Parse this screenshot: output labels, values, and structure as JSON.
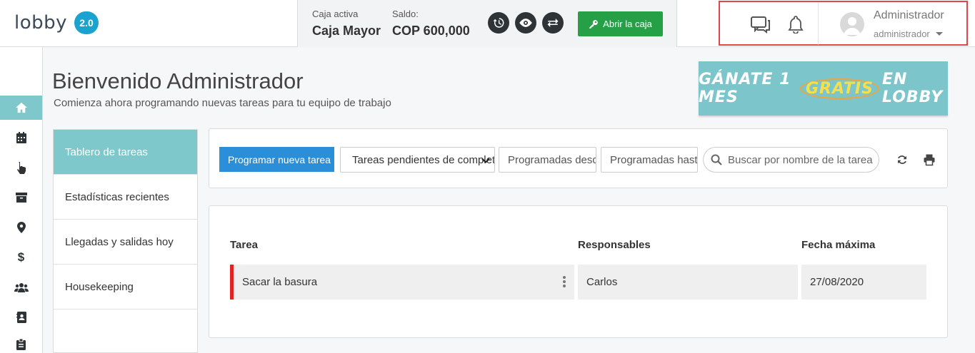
{
  "brand": {
    "logo_text": "lobby",
    "version": "2.0"
  },
  "cashbox": {
    "active_label": "Caja activa",
    "active_value": "Caja Mayor",
    "balance_label": "Saldo:",
    "balance_value": "COP 600,000",
    "open_button": "Abrir la caja",
    "icons": [
      "history-icon",
      "eye-icon",
      "transfer-icon",
      "key-icon"
    ]
  },
  "user": {
    "name": "Administrador",
    "role": "administrador",
    "icons": [
      "chat-icon",
      "bell-icon",
      "avatar-icon",
      "chevron-down-icon"
    ]
  },
  "sidebar": {
    "icons": [
      "home-icon",
      "calendar-icon",
      "pointer-hand-icon",
      "archive-icon",
      "location-pin-icon",
      "dollar-icon",
      "users-icon",
      "contact-book-icon",
      "clipboard-icon"
    ],
    "active_index": 0
  },
  "page": {
    "title": "Bienvenido Administrador",
    "subtitle": "Comienza ahora programando nuevas tareas para tu equipo de trabajo"
  },
  "promo": {
    "before": "GÁNATE 1 MES",
    "highlight": "GRATIS",
    "after": "EN LOBBY",
    "accent": "#7cc6cb"
  },
  "tabs": [
    {
      "label": "Tablero de tareas",
      "active": true
    },
    {
      "label": "Estadísticas recientes",
      "active": false
    },
    {
      "label": "Llegadas y salidas hoy",
      "active": false
    },
    {
      "label": "Housekeeping",
      "active": false
    }
  ],
  "toolbar": {
    "program_button": "Programar nueva tarea",
    "filter_selected": "Tareas pendientes de completar",
    "from_placeholder": "Programadas desde",
    "to_placeholder": "Programadas hasta",
    "search_placeholder": "Buscar por nombre de la tarea",
    "icons": [
      "search-icon",
      "refresh-icon",
      "print-icon"
    ]
  },
  "table": {
    "columns": [
      "Tarea",
      "Responsables",
      "Fecha máxima"
    ],
    "rows": [
      {
        "task": "Sacar la basura",
        "assignees": "Carlos",
        "due": "27/08/2020",
        "flag_color": "#e02424"
      }
    ]
  }
}
